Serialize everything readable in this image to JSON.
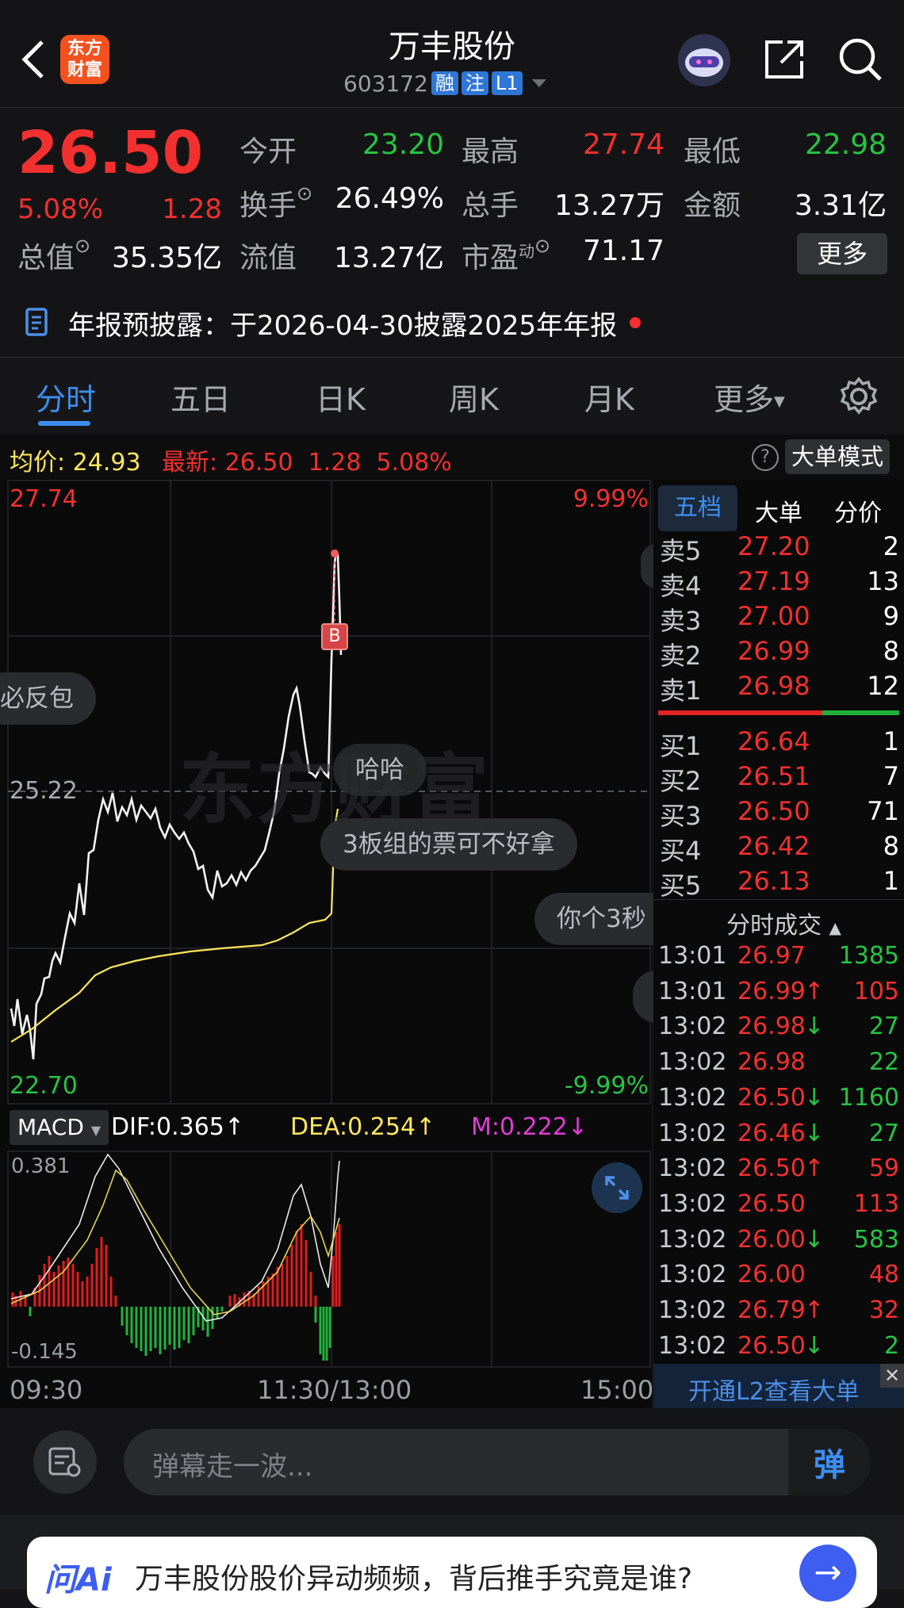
{
  "header": {
    "stock_name": "万丰股份",
    "stock_code": "603172",
    "tags": [
      "融",
      "注",
      "L1"
    ],
    "logo_text": "东方财富"
  },
  "quote": {
    "price": "26.50",
    "change_pct": "5.08%",
    "change": "1.28",
    "open_label": "今开",
    "open": "23.20",
    "high_label": "最高",
    "high": "27.74",
    "low_label": "最低",
    "low": "22.98",
    "turnover_label": "换手",
    "turnover": "26.49%",
    "volume_label": "总手",
    "volume": "13.27万",
    "amount_label": "金额",
    "amount": "3.31亿",
    "total_cap_label": "总值",
    "total_cap": "35.35亿",
    "float_cap_label": "流值",
    "float_cap": "13.27亿",
    "pe_label": "市盈",
    "pe_sup": "动",
    "pe": "71.17",
    "more_button": "更多"
  },
  "notice": {
    "text": "年报预披露：于2026-04-30披露2025年年报"
  },
  "tabs": {
    "items": [
      "分时",
      "五日",
      "日K",
      "周K",
      "月K",
      "更多"
    ],
    "active": "分时"
  },
  "info_bar": {
    "avg_label": "均价:",
    "avg_value": "24.93",
    "latest_label": "最新:",
    "latest_value": "26.50",
    "latest_change": "1.28",
    "latest_pct": "5.08%",
    "mode_button": "大单模式"
  },
  "chart": {
    "top_price": "27.74",
    "top_pct": "9.99%",
    "bottom_price": "22.70",
    "bottom_pct": "-9.99%",
    "mid_price": "25.22",
    "buy_marker": "B",
    "watermark": "东方财富",
    "time_start": "09:30",
    "time_mid": "11:30/13:00",
    "time_end": "15:00"
  },
  "danmaku": [
    "必反包",
    "哈哈",
    "3板组的票可不好拿",
    "你个3秒"
  ],
  "macd": {
    "label": "MACD",
    "dif": "DIF:0.365↑",
    "dea": "DEA:0.254↑",
    "m": "M:0.222↓",
    "top": "0.381",
    "bottom": "-0.145"
  },
  "orderbook": {
    "tabs": [
      "五档",
      "大单",
      "分价"
    ],
    "asks": [
      {
        "label": "卖5",
        "price": "27.20",
        "vol": "2"
      },
      {
        "label": "卖4",
        "price": "27.19",
        "vol": "13"
      },
      {
        "label": "卖3",
        "price": "27.00",
        "vol": "9"
      },
      {
        "label": "卖2",
        "price": "26.99",
        "vol": "8"
      },
      {
        "label": "卖1",
        "price": "26.98",
        "vol": "12"
      }
    ],
    "bids": [
      {
        "label": "买1",
        "price": "26.64",
        "vol": "1"
      },
      {
        "label": "买2",
        "price": "26.51",
        "vol": "7"
      },
      {
        "label": "买3",
        "price": "26.50",
        "vol": "71"
      },
      {
        "label": "买4",
        "price": "26.42",
        "vol": "8"
      },
      {
        "label": "买5",
        "price": "26.13",
        "vol": "1"
      }
    ],
    "trades_title": "分时成交",
    "trades": [
      {
        "time": "13:01",
        "price": "26.97",
        "arrow": "",
        "vol": "1385",
        "vcolor": "green"
      },
      {
        "time": "13:01",
        "price": "26.99",
        "arrow": "↑",
        "vol": "105",
        "vcolor": "red"
      },
      {
        "time": "13:02",
        "price": "26.98",
        "arrow": "↓",
        "vol": "27",
        "vcolor": "green"
      },
      {
        "time": "13:02",
        "price": "26.98",
        "arrow": "",
        "vol": "22",
        "vcolor": "green"
      },
      {
        "time": "13:02",
        "price": "26.50",
        "arrow": "↓",
        "vol": "1160",
        "vcolor": "green"
      },
      {
        "time": "13:02",
        "price": "26.46",
        "arrow": "↓",
        "vol": "27",
        "vcolor": "green"
      },
      {
        "time": "13:02",
        "price": "26.50",
        "arrow": "↑",
        "vol": "59",
        "vcolor": "red"
      },
      {
        "time": "13:02",
        "price": "26.50",
        "arrow": "",
        "vol": "113",
        "vcolor": "red"
      },
      {
        "time": "13:02",
        "price": "26.00",
        "arrow": "↓",
        "vol": "583",
        "vcolor": "green"
      },
      {
        "time": "13:02",
        "price": "26.00",
        "arrow": "",
        "vol": "48",
        "vcolor": "red"
      },
      {
        "time": "13:02",
        "price": "26.79",
        "arrow": "↑",
        "vol": "32",
        "vcolor": "red"
      },
      {
        "time": "13:02",
        "price": "26.50",
        "arrow": "↓",
        "vol": "2",
        "vcolor": "green"
      }
    ],
    "l2_link": "开通L2查看大单"
  },
  "input": {
    "placeholder": "弹幕走一波...",
    "send_label": "弹"
  },
  "ai_banner": {
    "logo": "问Ai",
    "text": "万丰股份股价异动频频，背后推手究竟是谁?"
  }
}
